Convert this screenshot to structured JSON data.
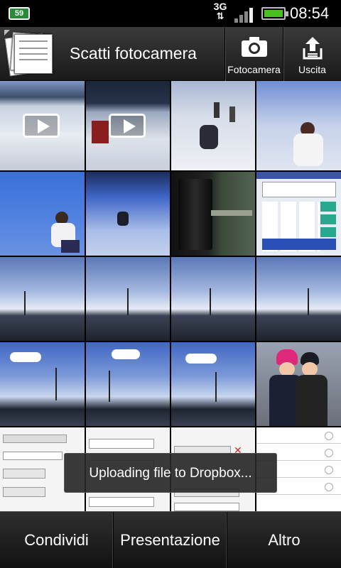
{
  "status_bar": {
    "notification_badge": "59",
    "network": "3G",
    "time": "08:54"
  },
  "action_bar": {
    "title": "Scatti fotocamera",
    "camera_label": "Fotocamera",
    "exit_label": "Uscita"
  },
  "grid": {
    "thumbnails": [
      {
        "scene": "snow-slope",
        "video": true
      },
      {
        "scene": "snow-slope-dark",
        "video": true
      },
      {
        "scene": "snow-people",
        "video": false
      },
      {
        "scene": "snow-child",
        "video": false
      },
      {
        "scene": "snow-blue",
        "video": false
      },
      {
        "scene": "snow-hill",
        "video": false
      },
      {
        "scene": "lens-extension-tube",
        "video": false
      },
      {
        "scene": "calculator-screenshot",
        "video": false
      },
      {
        "scene": "harbor-sunset",
        "video": false
      },
      {
        "scene": "harbor-sunset",
        "video": false
      },
      {
        "scene": "harbor-sunset",
        "video": false
      },
      {
        "scene": "harbor-sunset",
        "video": false
      },
      {
        "scene": "harbor-sky",
        "video": false
      },
      {
        "scene": "harbor-sky",
        "video": false
      },
      {
        "scene": "harbor-sky",
        "video": false
      },
      {
        "scene": "two-children",
        "video": false
      },
      {
        "scene": "calendar-form-screenshot",
        "video": false
      },
      {
        "scene": "form-screenshot",
        "video": false
      },
      {
        "scene": "form-screenshot",
        "video": false
      },
      {
        "scene": "list-screenshot",
        "video": false
      }
    ]
  },
  "toast": "Uploading file to Dropbox...",
  "bottom_bar": {
    "share_label": "Condividi",
    "slideshow_label": "Presentazione",
    "more_label": "Altro"
  },
  "colors": {
    "battery_green": "#46c11e",
    "toolbar_dark": "#1a1a1a"
  }
}
